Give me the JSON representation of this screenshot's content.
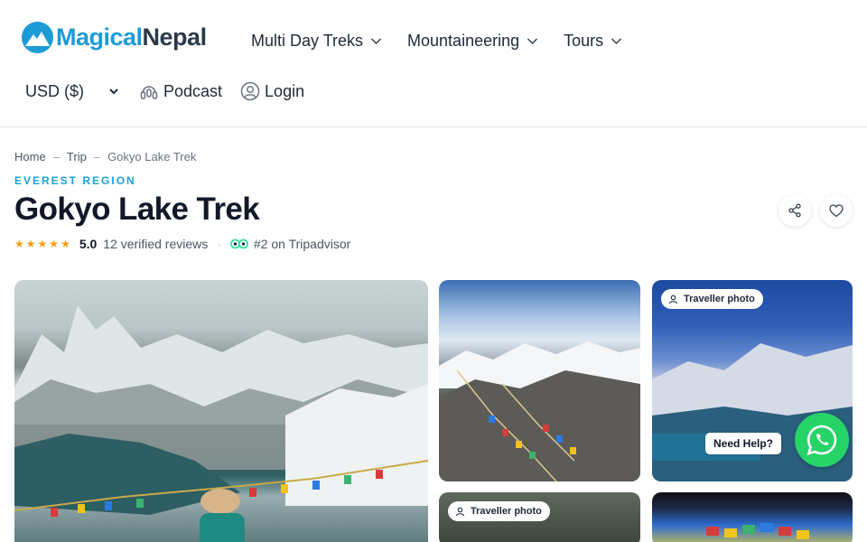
{
  "header": {
    "logo": {
      "part1": "Magical",
      "part2": "Nepal"
    },
    "nav": [
      {
        "label": "Multi Day Treks",
        "icon": "chevron-down-icon"
      },
      {
        "label": "Mountaineering",
        "icon": "chevron-down-icon"
      },
      {
        "label": "Tours",
        "icon": "chevron-down-icon"
      }
    ],
    "currency": {
      "label": "USD ($)",
      "icon": "chevron-down-icon"
    },
    "podcast": {
      "label": "Podcast",
      "icon": "podcast-icon"
    },
    "login": {
      "label": "Login",
      "icon": "user-circle-icon"
    }
  },
  "breadcrumb": [
    {
      "label": "Home"
    },
    {
      "label": "Trip"
    },
    {
      "label": "Gokyo Lake Trek"
    }
  ],
  "trip": {
    "region": "EVEREST REGION",
    "title": "Gokyo Lake Trek",
    "rating": {
      "stars": 5,
      "score": "5.0",
      "reviews": "12 verified reviews"
    },
    "tripadvisor": "#2 on Tripadvisor",
    "actions": {
      "share_icon": "share-icon",
      "favorite_icon": "heart-icon"
    }
  },
  "gallery": {
    "badges": [
      "Traveller photo",
      "Traveller photo"
    ]
  },
  "help": {
    "label": "Need Help?",
    "icon": "whatsapp-icon"
  },
  "colors": {
    "brand_blue": "#1e9bd7",
    "brand_dark": "#2b3a4a",
    "region_accent": "#1aa2d8",
    "star": "#f59e0b",
    "tripadvisor_green": "#34e0a1",
    "whatsapp": "#25d366"
  }
}
